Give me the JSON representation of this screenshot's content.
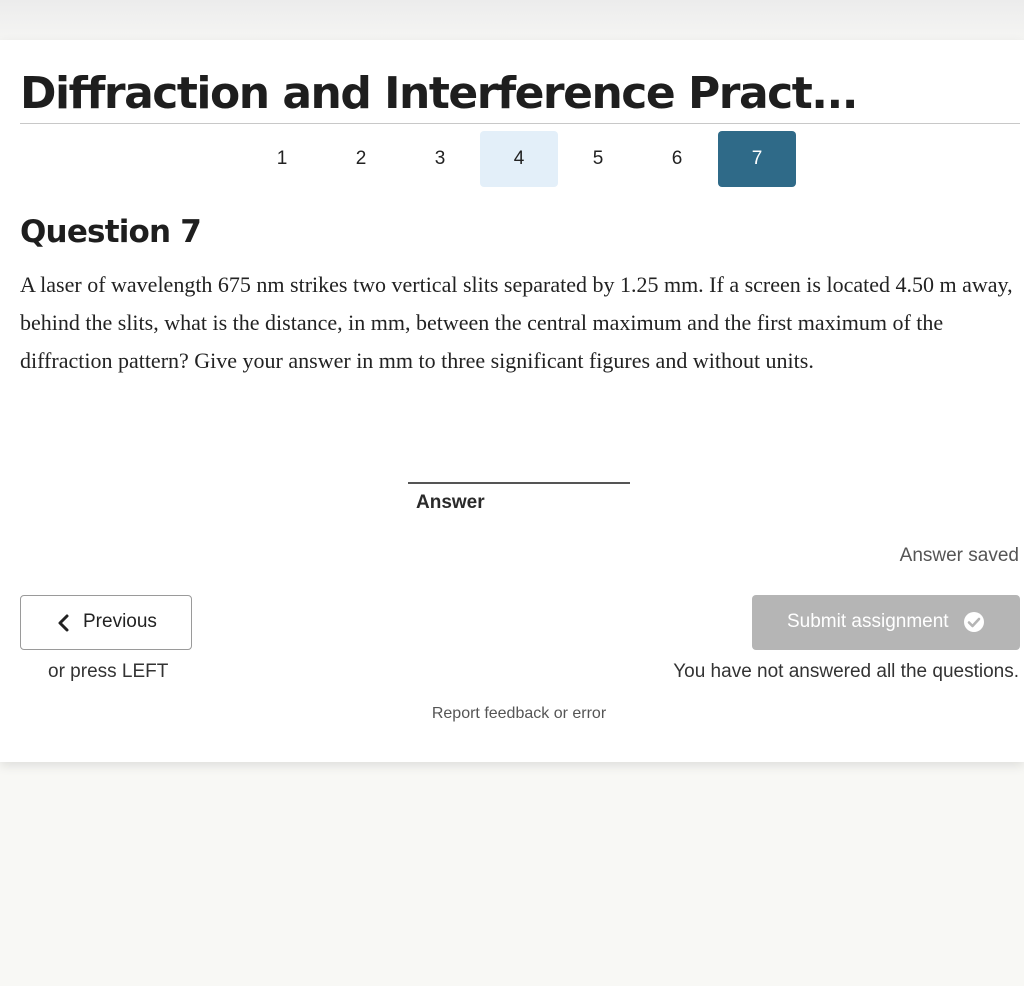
{
  "assignment": {
    "title": "Diffraction and Interference Pract..."
  },
  "pagination": {
    "pages": [
      "1",
      "2",
      "3",
      "4",
      "5",
      "6",
      "7"
    ],
    "visited_page": "4",
    "current_page": "7",
    "colors": {
      "visited_bg": "#e3eff9",
      "current_bg": "#2f6a88"
    }
  },
  "question": {
    "title": "Question 7",
    "text": "A laser of wavelength 675 nm strikes two vertical slits separated by 1.25 mm. If a screen is located 4.50 m away, behind the slits, what is the distance, in mm, between the central maximum and the first maximum of the diffraction pattern? Give your answer in mm to three significant figures and without units."
  },
  "answer": {
    "value": "",
    "label": "Answer",
    "status": "Answer saved"
  },
  "navigation": {
    "previous_icon": "chevron-left-icon",
    "previous_label": "Previous",
    "previous_hint": "or press LEFT",
    "submit_label": "Submit assignment",
    "submit_icon": "check-circle-icon",
    "submit_color": "#b5b5b5",
    "submit_warning": "You have not answered all the questions."
  },
  "footer": {
    "report_link": "Report feedback or error"
  }
}
